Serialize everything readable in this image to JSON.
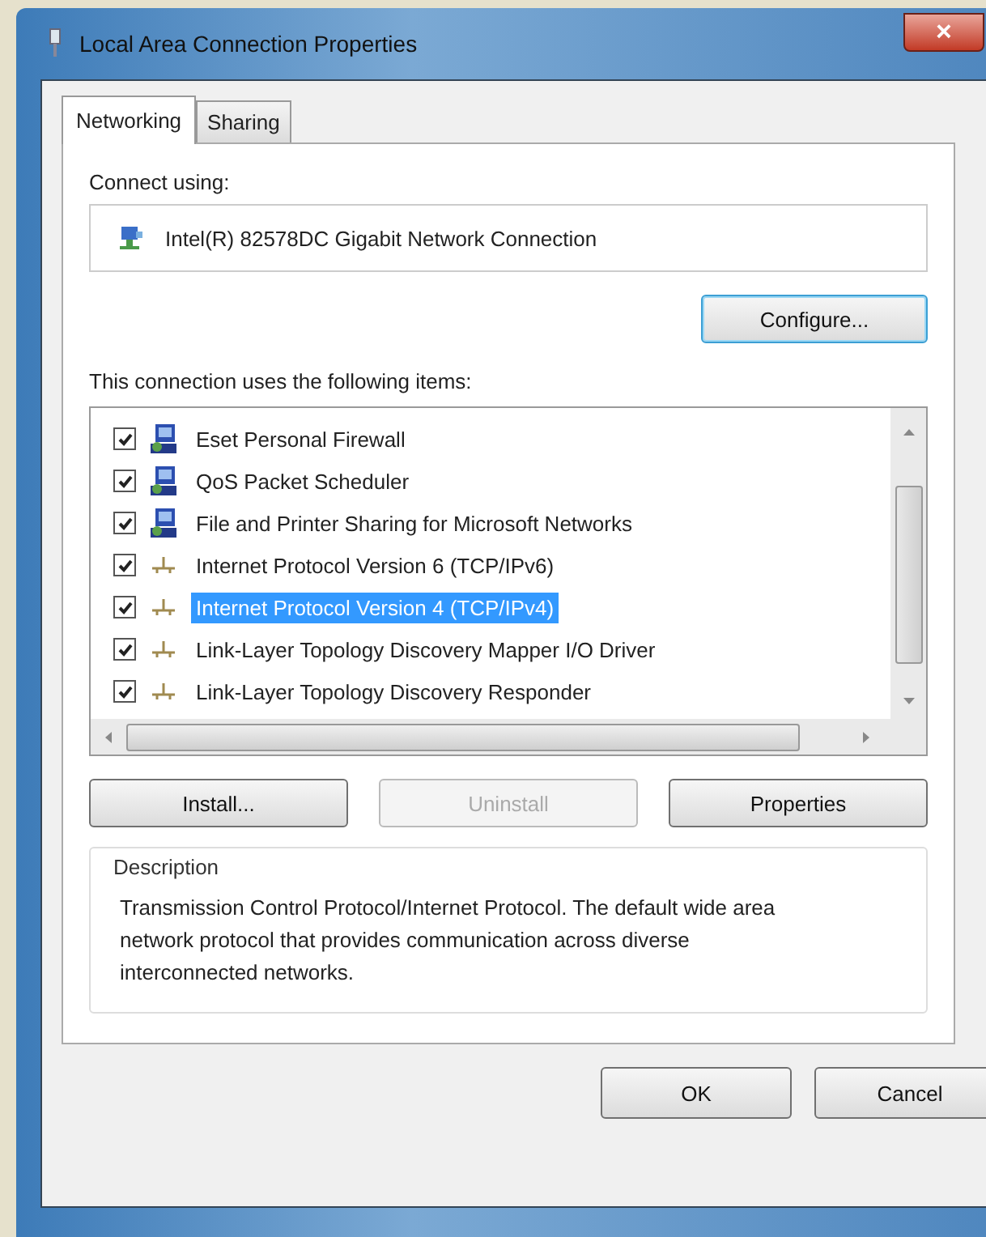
{
  "window": {
    "title": "Local Area Connection Properties",
    "close": "×"
  },
  "tabs": [
    {
      "label": "Networking",
      "selected": true
    },
    {
      "label": "Sharing",
      "selected": false
    }
  ],
  "connect_using": {
    "label": "Connect using:",
    "adapter": "Intel(R) 82578DC Gigabit Network Connection",
    "configure_button": "Configure..."
  },
  "items_label": "This connection uses the following items:",
  "items": [
    {
      "label": "Eset Personal Firewall",
      "kind": "service",
      "checked": true,
      "selected": false
    },
    {
      "label": "QoS Packet Scheduler",
      "kind": "service",
      "checked": true,
      "selected": false
    },
    {
      "label": "File and Printer Sharing for Microsoft Networks",
      "kind": "service",
      "checked": true,
      "selected": false
    },
    {
      "label": "Internet Protocol Version 6 (TCP/IPv6)",
      "kind": "protocol",
      "checked": true,
      "selected": false
    },
    {
      "label": "Internet Protocol Version 4 (TCP/IPv4)",
      "kind": "protocol",
      "checked": true,
      "selected": true
    },
    {
      "label": "Link-Layer Topology Discovery Mapper I/O Driver",
      "kind": "protocol",
      "checked": true,
      "selected": false
    },
    {
      "label": "Link-Layer Topology Discovery Responder",
      "kind": "protocol",
      "checked": true,
      "selected": false
    }
  ],
  "item_buttons": [
    {
      "label": "Install...",
      "disabled": false
    },
    {
      "label": "Uninstall",
      "disabled": true
    },
    {
      "label": "Properties",
      "disabled": false
    }
  ],
  "description": {
    "title": "Description",
    "text": "Transmission Control Protocol/Internet Protocol. The default wide area network protocol that provides communication across diverse interconnected networks."
  },
  "buttons": [
    "OK",
    "Cancel"
  ]
}
